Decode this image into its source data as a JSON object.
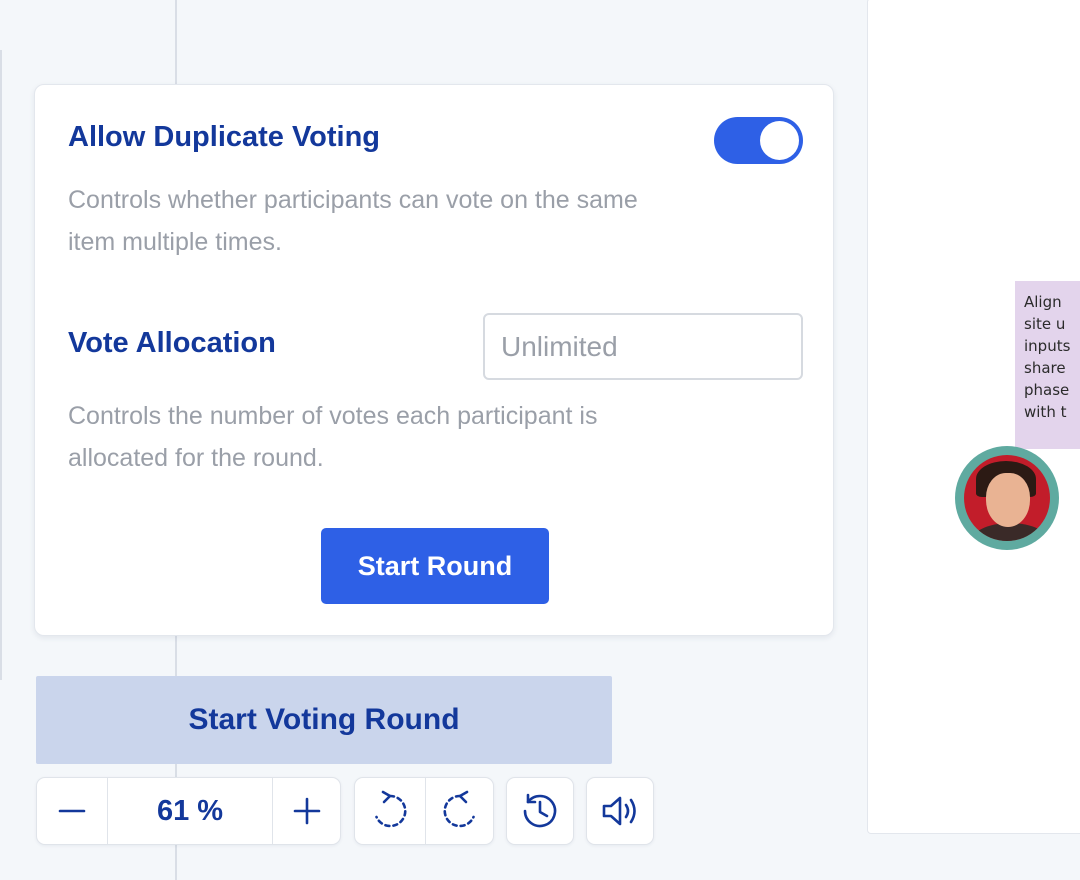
{
  "voting_settings": {
    "duplicate_voting": {
      "title": "Allow Duplicate Voting",
      "enabled": true,
      "description_lines": [
        "Controls whether participants can vote on the same",
        "item multiple times."
      ]
    },
    "vote_allocation": {
      "title": "Vote Allocation",
      "value": "",
      "placeholder": "Unlimited",
      "description_lines": [
        "Controls the number of votes each participant is",
        "allocated for the round."
      ]
    },
    "start_round_label": "Start Round"
  },
  "start_voting_round_label": "Start Voting Round",
  "toolbar": {
    "zoom_value": "61 %",
    "icons": [
      "minus-icon",
      "plus-icon",
      "undo-icon",
      "redo-icon",
      "history-icon",
      "speaker-icon"
    ]
  },
  "canvas": {
    "sticky_note_lines": [
      "Align",
      "site u",
      "inputs",
      "share",
      "phase",
      "with t"
    ],
    "sticky_color": "#e3d4ec",
    "avatar_ring_color": "#5faaa0"
  },
  "colors": {
    "accent": "#2e60e6",
    "heading": "#13389b",
    "muted_text": "#9a9fa8",
    "secondary_button_bg": "#cad5ec"
  }
}
